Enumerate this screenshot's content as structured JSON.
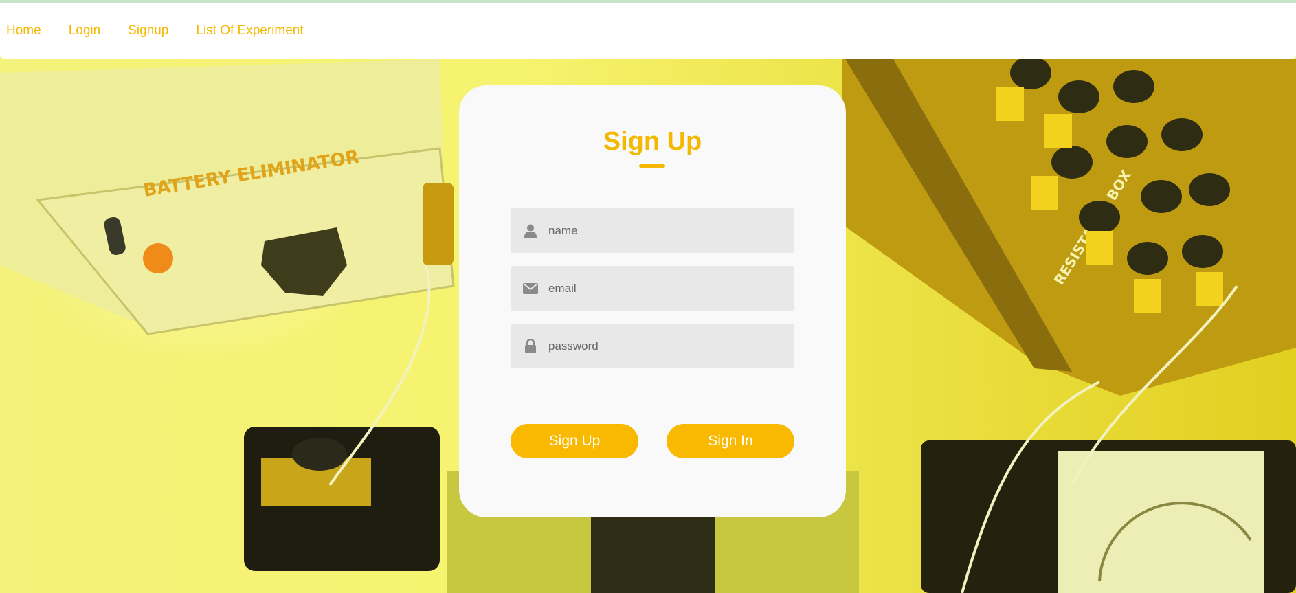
{
  "nav": {
    "items": [
      {
        "label": "Home"
      },
      {
        "label": "Login"
      },
      {
        "label": "Signup"
      },
      {
        "label": "List Of Experiment"
      }
    ]
  },
  "background": {
    "battery_label": "BATTERY ELIMINATOR",
    "resistance_label": "RESISTANCE BOX"
  },
  "form": {
    "title": "Sign Up",
    "name_placeholder": "name",
    "email_placeholder": "email",
    "password_placeholder": "password",
    "signup_label": "Sign Up",
    "signin_label": "Sign In"
  },
  "colors": {
    "accent": "#f5b800",
    "button": "#f8b900",
    "overlay": "#f7f56a"
  },
  "icons": {
    "name": "user-icon",
    "email": "envelope-icon",
    "password": "lock-icon"
  }
}
